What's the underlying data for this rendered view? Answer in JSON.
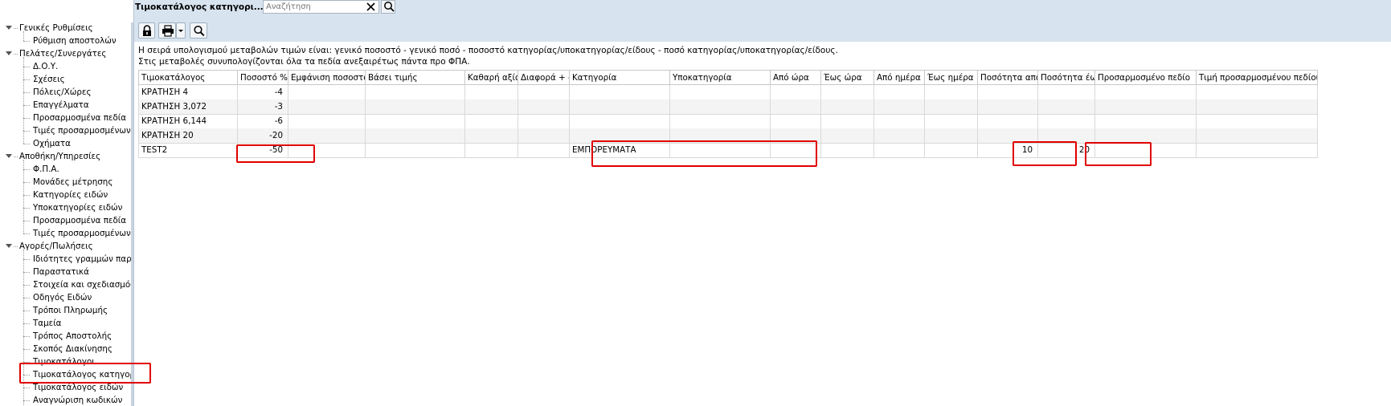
{
  "window": {
    "title": "Τιμοκατάλογος κατηγορι...",
    "search_placeholder": "Αναζήτηση"
  },
  "toolbar": {
    "buttons": [
      "lock-icon",
      "printer-icon",
      "dropdown-arrow-icon",
      "magnifier-icon"
    ]
  },
  "info": {
    "line1": "Η σειρά υπολογισμού μεταβολών τιμών είναι: γενικό ποσοστό - γενικό ποσό - ποσοστό κατηγορίας/υποκατηγορίας/είδους - ποσό κατηγορίας/υποκατηγορίας/είδους.",
    "line2": "Στις μεταβολές συνυπολογίζονται όλα τα πεδία ανεξαιρέτως πάντα προ ΦΠΑ."
  },
  "sidebar": {
    "nodes": [
      {
        "level": 0,
        "label": "Γενικές Ρυθμίσεις"
      },
      {
        "level": 1,
        "label": "Ρύθμιση αποστολών"
      },
      {
        "level": 0,
        "label": "Πελάτες/Συνεργάτες"
      },
      {
        "level": 1,
        "label": "Δ.Ο.Υ."
      },
      {
        "level": 1,
        "label": "Σχέσεις"
      },
      {
        "level": 1,
        "label": "Πόλεις/Χώρες"
      },
      {
        "level": 1,
        "label": "Επαγγέλματα"
      },
      {
        "level": 1,
        "label": "Προσαρμοσμένα πεδία"
      },
      {
        "level": 1,
        "label": "Τιμές προσαρμοσμένων π"
      },
      {
        "level": 1,
        "label": "Οχήματα"
      },
      {
        "level": 0,
        "label": "Αποθήκη/Υπηρεσίες"
      },
      {
        "level": 1,
        "label": "Φ.Π.Α."
      },
      {
        "level": 1,
        "label": "Μονάδες μέτρησης"
      },
      {
        "level": 1,
        "label": "Κατηγορίες ειδών"
      },
      {
        "level": 1,
        "label": "Υποκατηγορίες ειδών"
      },
      {
        "level": 1,
        "label": "Προσαρμοσμένα πεδία"
      },
      {
        "level": 1,
        "label": "Τιμές προσαρμοσμένων π"
      },
      {
        "level": 0,
        "label": "Αγορές/Πωλήσεις"
      },
      {
        "level": 1,
        "label": "Ιδιότητες γραμμών παρασ"
      },
      {
        "level": 1,
        "label": "Παραστατικά"
      },
      {
        "level": 1,
        "label": "Στοιχεία και σχεδιασμός π"
      },
      {
        "level": 1,
        "label": "Οδηγός Ειδών"
      },
      {
        "level": 1,
        "label": "Τρόποι Πληρωμής"
      },
      {
        "level": 1,
        "label": "Ταμεία"
      },
      {
        "level": 1,
        "label": "Τρόπος Αποστολής"
      },
      {
        "level": 1,
        "label": "Σκοπός Διακίνησης"
      },
      {
        "level": 1,
        "label": "Τιμοκατάλογοι"
      },
      {
        "level": 1,
        "label": "Τιμοκατάλογος κατηγοριώ"
      },
      {
        "level": 1,
        "label": "Τιμοκατάλογος ειδών"
      },
      {
        "level": 1,
        "label": "Αναγνώριση κωδικών"
      }
    ]
  },
  "grid": {
    "columns": [
      "Τιμοκατάλογος",
      "Ποσοστό % + -",
      "Εμφάνιση ποσοστού %",
      "Βάσει τιμής",
      "Καθαρή αξία",
      "Διαφορά + -",
      "Κατηγορία",
      "Υποκατηγορία",
      "Από ώρα",
      "Έως ώρα",
      "Από ημέρα",
      "Έως ημέρα",
      "Ποσότητα από",
      "Ποσότητα έως",
      "Προσαρμοσμένο πεδίο",
      "Τιμή προσαρμοσμένου πεδίου"
    ],
    "rows": [
      [
        "ΚΡΑΤΗΣΗ 4",
        "-4",
        "",
        "",
        "",
        "",
        "",
        "",
        "",
        "",
        "",
        "",
        "",
        "",
        "",
        ""
      ],
      [
        "ΚΡΑΤΗΣΗ 3,072",
        "-3",
        "",
        "",
        "",
        "",
        "",
        "",
        "",
        "",
        "",
        "",
        "",
        "",
        "",
        ""
      ],
      [
        "ΚΡΑΤΗΣΗ 6,144",
        "-6",
        "",
        "",
        "",
        "",
        "",
        "",
        "",
        "",
        "",
        "",
        "",
        "",
        "",
        ""
      ],
      [
        "ΚΡΑΤΗΣΗ 20",
        "-20",
        "",
        "",
        "",
        "",
        "",
        "",
        "",
        "",
        "",
        "",
        "",
        "",
        "",
        ""
      ],
      [
        "TEST2",
        "-50",
        "",
        "",
        "",
        "",
        "ΕΜΠΟΡΕΥΜΑΤΑ",
        "",
        "",
        "",
        "",
        "",
        "10",
        "20",
        "",
        ""
      ]
    ]
  },
  "colors": {
    "toolbar_bg": "#d7e3ef",
    "highlight_box": "#e00000"
  }
}
